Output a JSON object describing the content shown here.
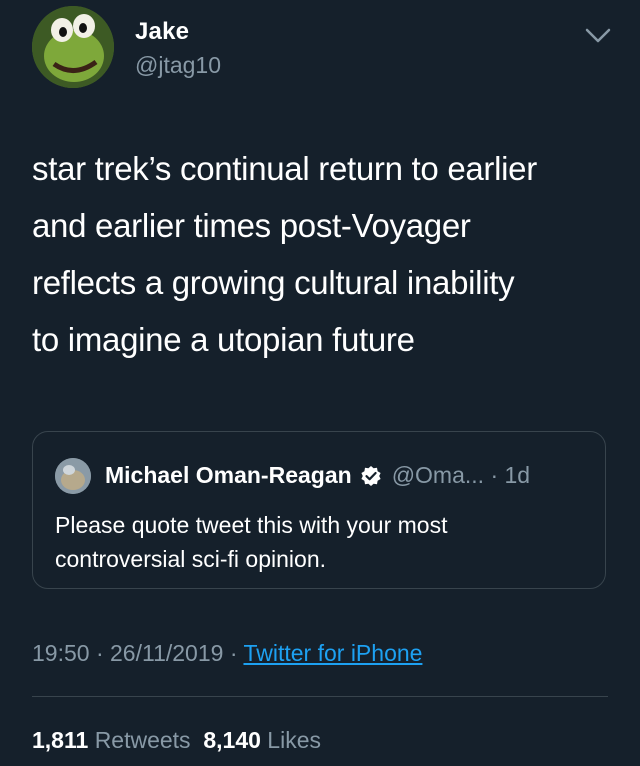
{
  "author": {
    "name": "Jake",
    "handle": "@jtag10"
  },
  "tweet": {
    "lines": [
      "star trek’s continual return to earlier",
      "and earlier times post-Voyager",
      "reflects a growing cultural inability",
      "to imagine a utopian future"
    ]
  },
  "quoted_tweet": {
    "name": "Michael Oman-Reagan",
    "handle": "@Oma...",
    "separator": "·",
    "age": "1d",
    "lines": [
      "Please quote tweet this with your most",
      "controversial sci-fi opinion."
    ]
  },
  "meta": {
    "time": "19:50",
    "date": "26/11/2019",
    "source": "Twitter for iPhone",
    "separator": "·"
  },
  "stats": {
    "retweets_count": "1,811",
    "retweets_label": "Retweets",
    "likes_count": "8,140",
    "likes_label": "Likes"
  },
  "colors": {
    "background": "#15202b",
    "secondary_text": "#8899a6",
    "link": "#1da1f2",
    "border": "#38444d"
  },
  "icons": [
    "chevron-down-icon",
    "verified-badge-icon"
  ]
}
